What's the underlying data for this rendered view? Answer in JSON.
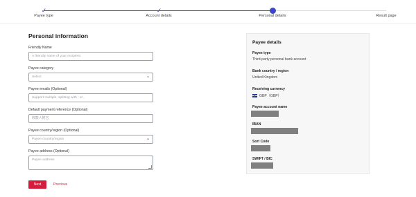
{
  "stepper": {
    "steps": [
      {
        "label": "Payee type",
        "state": "completed"
      },
      {
        "label": "Account details",
        "state": "completed"
      },
      {
        "label": "Personal details",
        "state": "current"
      },
      {
        "label": "Result page",
        "state": "upcoming"
      }
    ],
    "check_icon": "check-icon",
    "accent_color": "#3b47c4"
  },
  "form": {
    "title": "Personal information",
    "friendly_name": {
      "label": "Friendly Name",
      "placeholder": "A friendly name of your recipient."
    },
    "payee_category": {
      "label": "Payee category",
      "value": "Select",
      "icon": "chevron-down-icon"
    },
    "payee_emails": {
      "label": "Payee emails (Optional)",
      "placeholder": "Support multiple, splitting with ; or ,"
    },
    "default_reference": {
      "label": "Default payment reference (Optional)",
      "placeholder": "收款人附言"
    },
    "payee_country": {
      "label": "Payee country/region (Optional)",
      "value": "Payee country/region",
      "icon": "chevron-down-icon"
    },
    "payee_address": {
      "label": "Payee address (Optional)",
      "placeholder": "Payee address"
    },
    "next_label": "Next",
    "previous_label": "Previous",
    "button_color": "#d51e3b"
  },
  "payee_details": {
    "title": "Payee details",
    "payee_type_label": "Payee type",
    "payee_type_value": "Third-party personal bank account",
    "bank_country_label": "Bank country / region",
    "bank_country_value": "United Kingdom",
    "currency_label": "Receiving currency",
    "currency_value": "GBP（GBP）",
    "currency_icon": "uk-flag-icon",
    "account_name_label": "Payee account name",
    "iban_label": "IBAN",
    "sort_code_label": "Sort Code",
    "swift_label": "SWIFT / BIC",
    "redaction_color": "#808080"
  }
}
